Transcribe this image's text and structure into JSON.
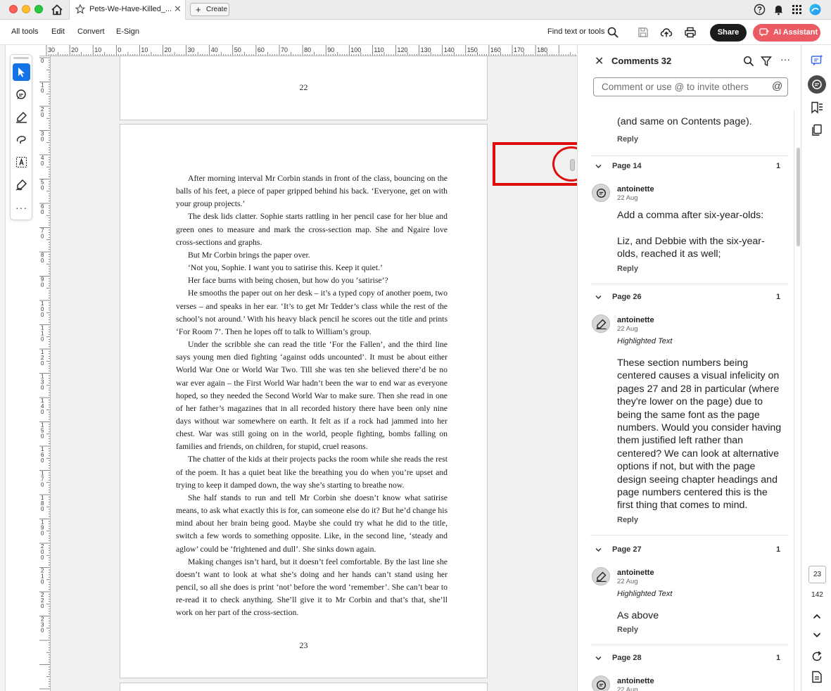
{
  "window": {
    "tab_title": "Pets-We-Have-Killed_...",
    "create_label": "Create"
  },
  "menu": {
    "items": [
      "All tools",
      "Edit",
      "Convert",
      "E-Sign"
    ],
    "find_label": "Find text or tools",
    "share_label": "Share",
    "ai_label": "AI Assistant"
  },
  "ruler": {
    "top_labels": [
      "30",
      "20",
      "10",
      "0",
      "10",
      "20",
      "30",
      "40",
      "50",
      "60",
      "70",
      "80",
      "90",
      "100",
      "110",
      "120",
      "130",
      "140",
      "150",
      "160",
      "170",
      "180"
    ],
    "left_labels": [
      "0",
      "1\n0",
      "2\n0",
      "3\n0",
      "4\n0",
      "5\n0",
      "6\n0",
      "7\n0",
      "8\n0",
      "9\n0",
      "1\n0\n0",
      "1\n1\n0",
      "1\n2\n0",
      "1\n3\n0",
      "1\n4\n0",
      "1\n5\n0",
      "1\n6\n0",
      "1\n7\n0",
      "1\n8\n0",
      "1\n9\n0",
      "2\n0\n0",
      "2\n1\n0",
      "2\n2\n0",
      "2\n3\n0"
    ]
  },
  "document": {
    "prev_page_number": "22",
    "current_page_number": "23",
    "paragraphs": [
      "After morning interval Mr Corbin stands in front of the class, bouncing on the balls of his feet, a piece of paper gripped behind his back. ‘Everyone, get on with your group projects.’",
      "The desk lids clatter. Sophie starts rattling in her pencil case for her blue and green ones to measure and mark the cross-section map. She and Ngaire love cross-sections and graphs.",
      "But Mr Corbin brings the paper over.",
      "‘Not you, Sophie. I want you to satirise this. Keep it quiet.’",
      "Her face burns with being chosen, but how do you ‘satirise’?",
      "He smooths the paper out on her desk – it’s a typed copy of another poem, two verses – and speaks in her ear. ‘It’s to get Mr Tedder’s class while the rest of the school’s not around.’ With his heavy black pencil he scores out the title and prints ‘For Room 7’. Then he lopes off to talk to William’s group.",
      "Under the scribble she can read the title ‘For the Fallen’, and the third line says young men died fighting ‘against odds uncounted’. It must be about either World War One or World War Two. Till she was ten she believed there’d be no war ever again – the First World War hadn’t been the war to end war as everyone hoped, so they needed the Second World War to make sure. Then she read in one of her father’s magazines that in all recorded history there have been only nine days without war somewhere on earth. It felt as if a rock had jammed into her chest. War was still going on in the world, people fighting, bombs falling on families and friends, on children, for stupid, cruel reasons.",
      "The chatter of the kids at their projects packs the room while she reads the rest of the poem. It has a quiet beat like the breathing you do when you’re upset and trying to keep it damped down, the way she’s starting to breathe now.",
      "She half stands to run and tell Mr Corbin she doesn’t know what satirise means, to ask what exactly this is for, can someone else do it? But he’d change his mind about her brain being good. Maybe she could try what he did to the title, switch a few words to something opposite. Like, in the second line, ‘steady and aglow’ could be ‘frightened and dull’. She sinks down again.",
      "Making changes isn’t hard, but it doesn’t feel comfortable. By the last line she doesn’t want to look at what she’s doing and her hands can’t stand using her pencil, so all she does is print ‘not’ before the word ‘remember’. She can’t bear to re-read it to check anything. She’ll give it to Mr Corbin and that’s that, she’ll work on her part of the cross-section."
    ]
  },
  "comments": {
    "title": "Comments 32",
    "input_placeholder": "Comment or use @ to invite others",
    "at_symbol": "@",
    "top_partial_text": "(and same on Contents page).",
    "top_partial_reply": "Reply",
    "groups": [
      {
        "page_label": "Page 14",
        "count": "1",
        "author": "antoinette",
        "date": "22 Aug",
        "type": "",
        "text_lines": [
          "Add a comma after six-year-olds:",
          "",
          "Liz, and Debbie with the six-year-",
          "olds, reached it as well;"
        ],
        "reply": "Reply"
      },
      {
        "page_label": "Page 26",
        "count": "1",
        "author": "antoinette",
        "date": "22 Aug",
        "type": "Highlighted Text",
        "text_lines": [
          "These section numbers being",
          "centered causes a visual infelicity on",
          "pages 27 and 28 in particular (where",
          "they're lower on the page) due to",
          "being the same font as the page",
          "numbers. Would you consider having",
          "them justified left rather than",
          "centered? We can look at alternative",
          "options if not, but with the page",
          "design seeing chapter headings and",
          "page numbers centered this is the",
          "first thing that comes to mind."
        ],
        "reply": "Reply"
      },
      {
        "page_label": "Page 27",
        "count": "1",
        "author": "antoinette",
        "date": "22 Aug",
        "type": "Highlighted Text",
        "text_lines": [
          "As above"
        ],
        "reply": "Reply"
      },
      {
        "page_label": "Page 28",
        "count": "1",
        "author": "antoinette",
        "date": "22 Aug",
        "type": "",
        "text_lines": [],
        "reply": ""
      }
    ]
  },
  "rail": {
    "current_page": "23",
    "total_pages": "142"
  },
  "colors": {
    "accent_blue": "#1473e6",
    "share_bg": "#1c1c1c",
    "ai_bg": "#ec5a64",
    "annotation_red": "#e00d0d"
  }
}
